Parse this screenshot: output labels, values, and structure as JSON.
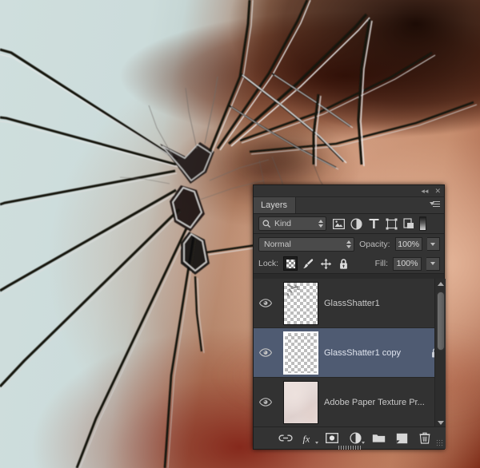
{
  "app": {
    "background_description": "Blurred close-up of a face behind shattered glass"
  },
  "panel": {
    "titlebar": {
      "collapse_label": "◂◂",
      "close_label": "✕"
    },
    "tab_label": "Layers",
    "menu_icon": "panel-menu-icon",
    "filter": {
      "search_icon": "search-icon",
      "kind_label": "Kind",
      "icons": [
        {
          "name": "filter-pixel-icon",
          "title": "Pixel layers"
        },
        {
          "name": "filter-adjustment-icon",
          "title": "Adjustment layers"
        },
        {
          "name": "filter-type-icon",
          "title": "Type layers"
        },
        {
          "name": "filter-shape-icon",
          "title": "Shape layers"
        },
        {
          "name": "filter-smartobject-icon",
          "title": "Smart objects"
        }
      ],
      "toggle_name": "filter-enable-switch"
    },
    "blend": {
      "mode": "Normal",
      "opacity_label": "Opacity:",
      "opacity_value": "100%"
    },
    "lock": {
      "label": "Lock:",
      "fill_label": "Fill:",
      "fill_value": "100%",
      "buttons": [
        {
          "name": "lock-transparent-pixels",
          "active": true
        },
        {
          "name": "lock-image-pixels",
          "active": false
        },
        {
          "name": "lock-position",
          "active": false
        },
        {
          "name": "lock-all",
          "active": false
        }
      ]
    },
    "layers": [
      {
        "name": "GlassShatter1",
        "visible": true,
        "selected": false,
        "locked": false,
        "thumb_kind": "transparent-shards"
      },
      {
        "name": "GlassShatter1 copy",
        "visible": true,
        "selected": true,
        "locked": true,
        "thumb_kind": "transparent"
      },
      {
        "name": "Adobe Paper Texture Pr...",
        "visible": true,
        "selected": false,
        "locked": false,
        "thumb_kind": "paper"
      }
    ],
    "bottom_buttons": [
      {
        "name": "link-layers-button",
        "label": "link"
      },
      {
        "name": "layer-style-button",
        "label": "fx"
      },
      {
        "name": "add-layer-mask-button",
        "label": "mask"
      },
      {
        "name": "new-adjustment-layer-button",
        "label": "adjustment"
      },
      {
        "name": "new-group-button",
        "label": "group"
      },
      {
        "name": "new-layer-button",
        "label": "new layer"
      },
      {
        "name": "delete-layer-button",
        "label": "delete"
      }
    ]
  },
  "colors": {
    "panel_bg": "#333333",
    "list_bg": "#323232",
    "selection": "#4f5b72",
    "text": "#c9c9c9",
    "accent_text": "#dfe4ee"
  }
}
